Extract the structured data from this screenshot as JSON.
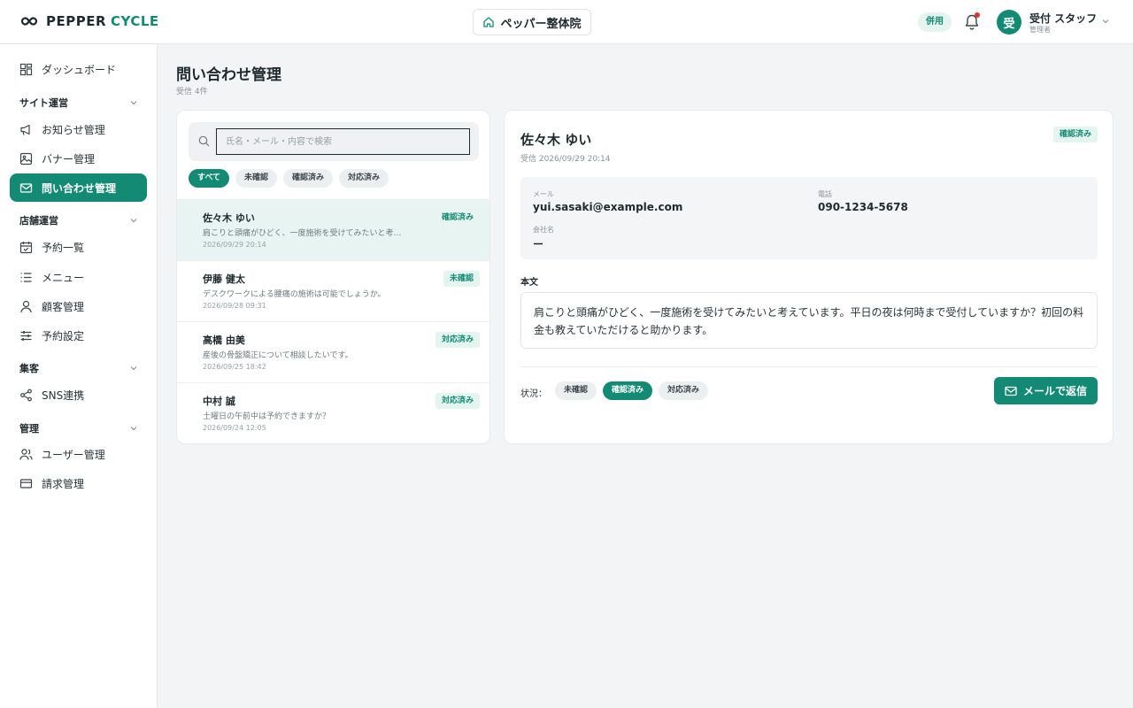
{
  "header": {
    "brand_part1": "PEPPER",
    "brand_part2": "CYCLE",
    "store_name": "ペッパー整体院",
    "plan_badge": "併用",
    "user_initial": "受",
    "user_name": "受付 スタッフ",
    "user_role": "管理者"
  },
  "sidebar": {
    "dashboard": "ダッシュボード",
    "section_site": "サイト運営",
    "news": "お知らせ管理",
    "banner": "バナー管理",
    "inquiry": "問い合わせ管理",
    "section_store": "店舗運営",
    "reservations": "予約一覧",
    "menu": "メニュー",
    "customers": "顧客管理",
    "booking_settings": "予約設定",
    "section_marketing": "集客",
    "sns": "SNS連携",
    "section_admin": "管理",
    "users": "ユーザー管理",
    "billing": "請求管理"
  },
  "page": {
    "title": "問い合わせ管理",
    "subtitle": "受信 4件"
  },
  "list": {
    "search_placeholder": "氏名・メール・内容で検索",
    "filters": [
      "すべて",
      "未確認",
      "確認済み",
      "対応済み"
    ],
    "items": [
      {
        "name": "佐々木 ゆい",
        "preview": "肩こりと頭痛がひどく、一度施術を受けてみたいと考…",
        "date": "2026/09/29 20:14",
        "status": "確認済み"
      },
      {
        "name": "伊藤 健太",
        "preview": "デスクワークによる腰痛の施術は可能でしょうか。",
        "date": "2026/09/28 09:31",
        "status": "未確認"
      },
      {
        "name": "高橋 由美",
        "preview": "産後の骨盤矯正について相談したいです。",
        "date": "2026/09/25 18:42",
        "status": "対応済み"
      },
      {
        "name": "中村 誠",
        "preview": "土曜日の午前中は予約できますか？",
        "date": "2026/09/24 12:05",
        "status": "対応済み"
      }
    ]
  },
  "detail": {
    "name": "佐々木 ゆい",
    "received": "受信 2026/09/29 20:14",
    "status_badge": "確認済み",
    "email_label": "メール",
    "email": "yui.sasaki@example.com",
    "phone_label": "電話",
    "phone": "090-1234-5678",
    "company_label": "会社名",
    "company": "ー",
    "body_label": "本文",
    "body": "肩こりと頭痛がひどく、一度施術を受けてみたいと考えています。平日の夜は何時まで受付していますか？初回の料金も教えていただけると助かります。",
    "status_label": "状況：",
    "status_options": [
      "未確認",
      "確認済み",
      "対応済み"
    ],
    "reply_button": "メールで返信"
  },
  "colors": {
    "accent": "#138a74",
    "accent_light": "#e4f4ef",
    "background": "#f2f4f5"
  }
}
